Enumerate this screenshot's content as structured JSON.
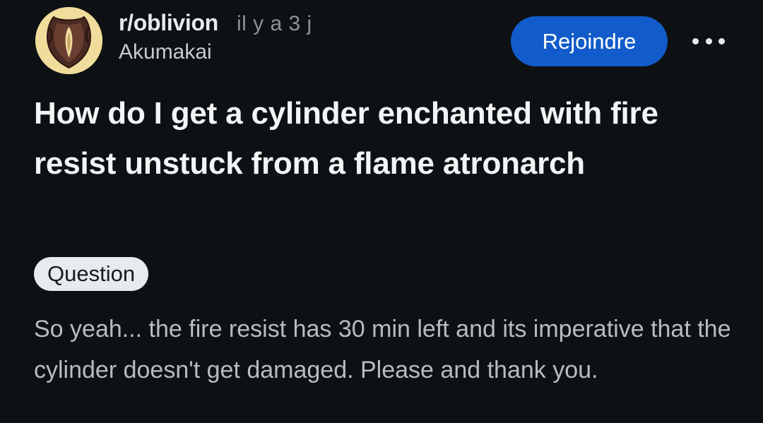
{
  "post": {
    "subreddit": "r/oblivion",
    "age": "il y a 3 j",
    "author": "Akumakai",
    "join_label": "Rejoindre",
    "more_icon": "more-horizontal-icon",
    "title": "How do I get a cylinder enchanted with fire resist unstuck from a flame atronarch",
    "flair": "Question",
    "body": "So yeah... the fire resist has 30 min left and its imperative that the cylinder doesn't get damaged. Please and thank you."
  },
  "colors": {
    "background": "#0e1113",
    "join_button": "#115bca",
    "flair_background": "#e5ebee",
    "avatar_background": "#f0dd9c"
  }
}
